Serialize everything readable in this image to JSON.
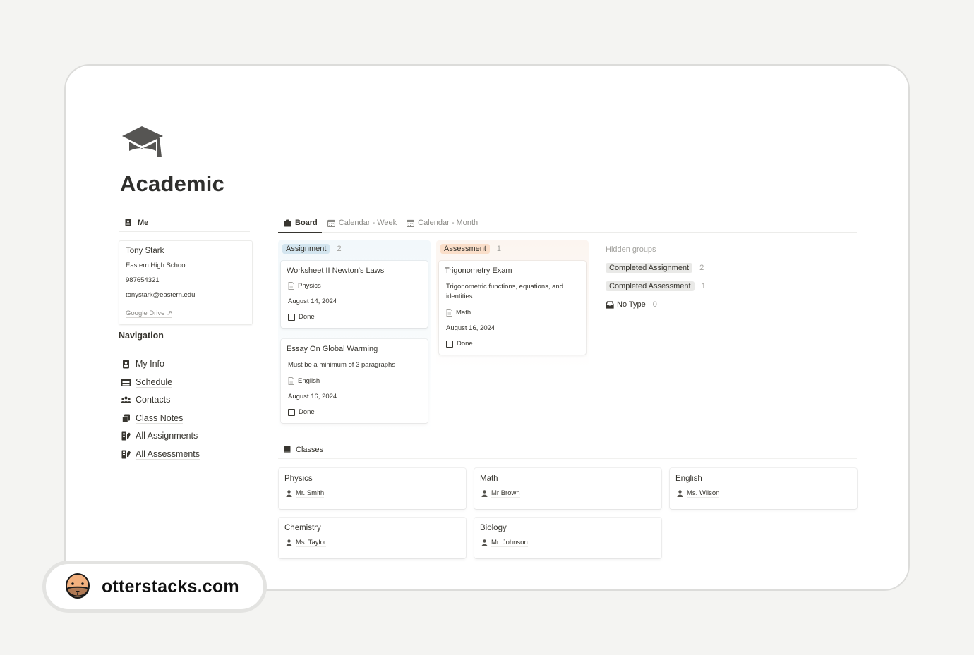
{
  "page": {
    "icon": "graduation-cap-icon",
    "title": "Academic"
  },
  "me": {
    "heading": "Me",
    "icon": "id-badge-icon",
    "profile": {
      "name": "Tony Stark",
      "school": "Eastern High School",
      "phone": "987654321",
      "email": "tonystark@eastern.edu",
      "link": "Google Drive ↗"
    }
  },
  "navigation": {
    "heading": "Navigation",
    "items": [
      {
        "label": "My Info",
        "icon": "id-badge-icon"
      },
      {
        "label": "Schedule",
        "icon": "table-icon"
      },
      {
        "label": "Contacts",
        "icon": "people-icon"
      },
      {
        "label": "Class Notes",
        "icon": "copy-pages-icon"
      },
      {
        "label": "All Assignments",
        "icon": "assignment-icon"
      },
      {
        "label": "All Assessments",
        "icon": "assignment-icon"
      }
    ]
  },
  "tabs": [
    {
      "label": "Board",
      "icon": "clipboard-icon",
      "active": true
    },
    {
      "label": "Calendar - Week",
      "icon": "calendar-icon",
      "active": false
    },
    {
      "label": "Calendar - Month",
      "icon": "calendar-icon",
      "active": false
    }
  ],
  "board": {
    "columns": [
      {
        "label": "Assignment",
        "count": "2",
        "color": "#d3e5ef",
        "cards": [
          {
            "title": "Worksheet II Newton's Laws",
            "subject": "Physics",
            "date": "August 14, 2024",
            "done_label": "Done"
          },
          {
            "title": "Essay On Global Warming",
            "description": "Must be a minimum of 3 paragraphs",
            "subject": "English",
            "date": "August 16, 2024",
            "done_label": "Done"
          }
        ]
      },
      {
        "label": "Assessment",
        "count": "1",
        "color": "#fadec9",
        "cards": [
          {
            "title": "Trigonometry Exam",
            "description": "Trigonometric functions, equations, and identities",
            "subject": "Math",
            "date": "August 16, 2024",
            "done_label": "Done"
          }
        ]
      }
    ],
    "hidden_groups": {
      "title": "Hidden groups",
      "groups": [
        {
          "label": "Completed Assignment",
          "count": "2"
        },
        {
          "label": "Completed Assessment",
          "count": "1"
        }
      ],
      "no_type": {
        "label": "No Type",
        "count": "0",
        "icon": "inbox-icon"
      }
    }
  },
  "classes": {
    "heading": "Classes",
    "icon": "book-icon",
    "items": [
      {
        "name": "Physics",
        "teacher": "Mr. Smith"
      },
      {
        "name": "Math",
        "teacher": "Mr Brown"
      },
      {
        "name": "English",
        "teacher": "Ms. Wilson"
      },
      {
        "name": "Chemistry",
        "teacher": "Ms. Taylor"
      },
      {
        "name": "Biology",
        "teacher": "Mr. Johnson"
      }
    ]
  },
  "brand": {
    "name": "otterstacks.com",
    "icon": "otter-face-icon"
  }
}
